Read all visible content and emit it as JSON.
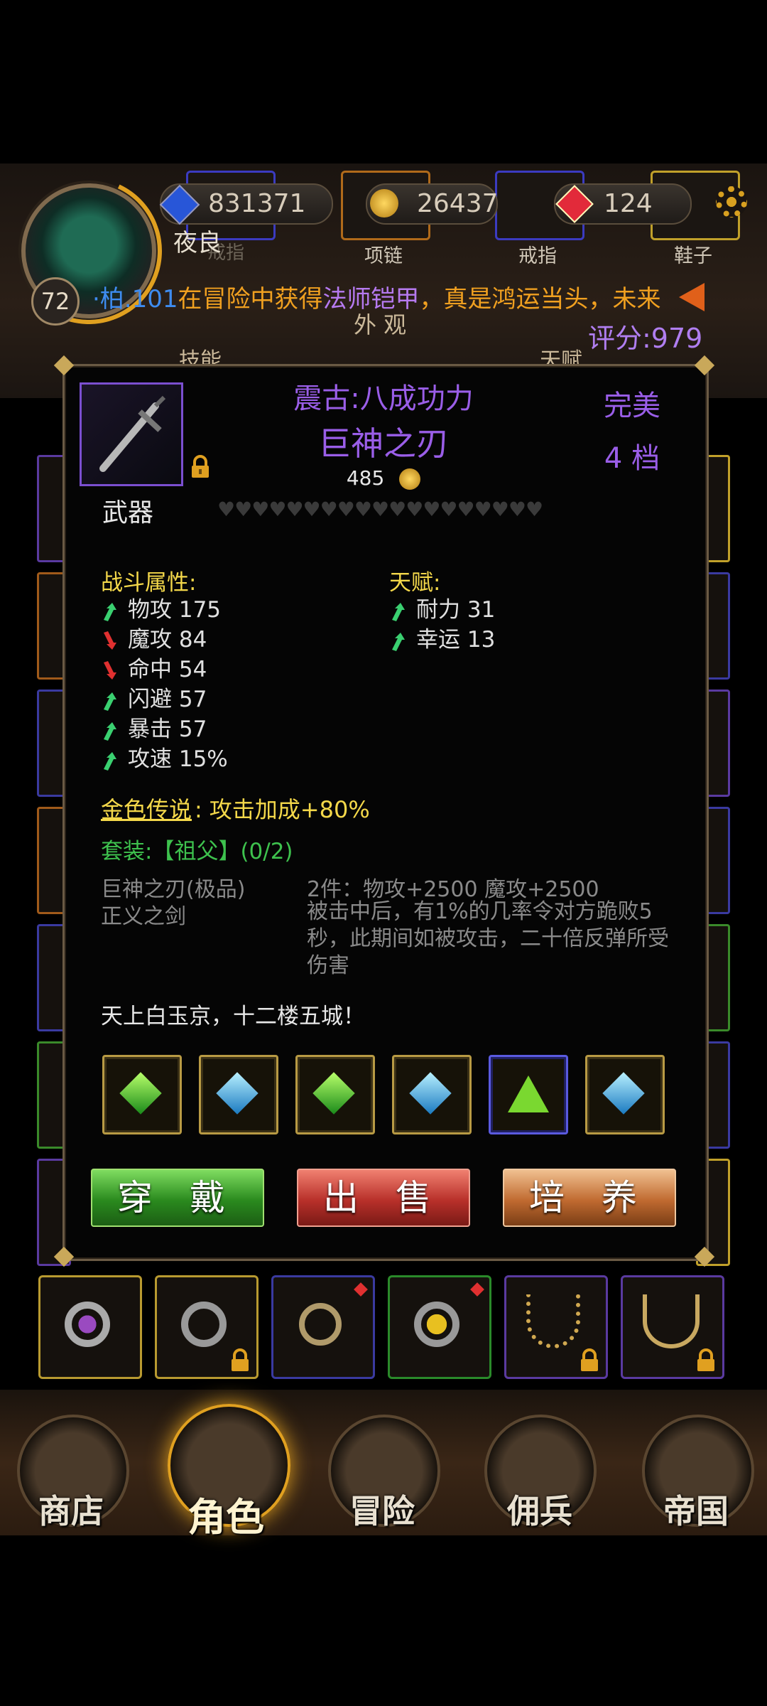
{
  "header": {
    "player_name": "夜良",
    "level": "72",
    "currency_blue": "831371",
    "currency_gold": "26437",
    "currency_red": "124",
    "slots": [
      {
        "label": "项链"
      },
      {
        "label": "戒指"
      },
      {
        "label": "鞋子"
      }
    ],
    "behind_slot_label": "戒指",
    "tabs": {
      "appearance": "外 观",
      "skill": "技能",
      "talent": "天赋"
    },
    "score_label": "评分:979"
  },
  "ticker": {
    "prefix": "·柏.101",
    "text1": "在冒险中获得",
    "item": "法师铠甲",
    "text2": "，真是鸿运当头，未来"
  },
  "item": {
    "title_line1": "震古:八成功力",
    "name": "巨神之刃",
    "quality": "完美",
    "grade": "4 档",
    "price": "485",
    "slot_type": "武器",
    "hearts": 19
  },
  "combat_stats": {
    "title": "战斗属性:",
    "rows": [
      {
        "label": "物攻 175",
        "dir": "up"
      },
      {
        "label": "魔攻 84",
        "dir": "down"
      },
      {
        "label": "命中 54",
        "dir": "down"
      },
      {
        "label": "闪避 57",
        "dir": "up"
      },
      {
        "label": "暴击 57",
        "dir": "up"
      },
      {
        "label": "攻速 15%",
        "dir": "up"
      }
    ]
  },
  "talent": {
    "title": "天赋:",
    "rows": [
      {
        "label": "耐力 31",
        "dir": "up"
      },
      {
        "label": "幸运 13",
        "dir": "up"
      }
    ]
  },
  "legend": {
    "label": "金色传说",
    "colon": ":",
    "effect": "攻击加成+80%"
  },
  "set": {
    "header": "套装:【祖父】(0/2)",
    "members": [
      "巨神之刃(极品)",
      "正义之剑"
    ],
    "bonus_title": "2件：物攻+2500 魔攻+2500",
    "bonus_desc": "被击中后，有1%的几率令对方跪败5秒，此期间如被攻击，二十倍反弹所受伤害"
  },
  "flavor": "天上白玉京，十二楼五城！",
  "gems": [
    {
      "color": "green"
    },
    {
      "color": "cyan"
    },
    {
      "color": "green"
    },
    {
      "color": "cyan"
    },
    {
      "color": "lime-triangle"
    },
    {
      "color": "cyan"
    }
  ],
  "buttons": {
    "equip": "穿 戴",
    "sell": "出 售",
    "upgrade": "培 养"
  },
  "nav": {
    "shop": "商店",
    "character": "角色",
    "adventure": "冒险",
    "mercenary": "佣兵",
    "empire": "帝国"
  },
  "colors": {
    "purple": "#9a5ee8",
    "gold": "#f4d84a",
    "green": "#3ec24e"
  }
}
